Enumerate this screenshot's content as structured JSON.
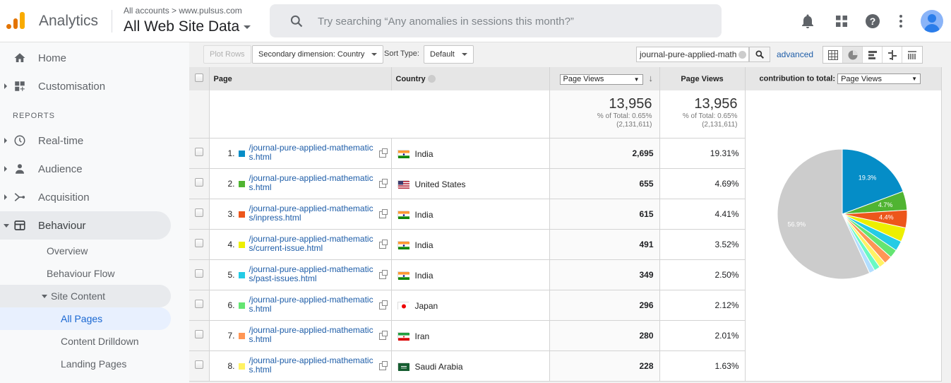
{
  "header": {
    "app_name": "Analytics",
    "breadcrumb": "All accounts > www.pulsus.com",
    "property": "All Web Site Data",
    "search_placeholder": "Try searching “Any anomalies in sessions this month?”",
    "icons": [
      "bell-icon",
      "apps-grid-icon",
      "help-icon",
      "more-vert-icon",
      "account-avatar-icon"
    ]
  },
  "sidebar": {
    "home": "Home",
    "customisation": "Customisation",
    "reports_label": "REPORTS",
    "realtime": "Real-time",
    "audience": "Audience",
    "acquisition": "Acquisition",
    "behaviour": "Behaviour",
    "behaviour_items": {
      "overview": "Overview",
      "flow": "Behaviour Flow",
      "site_content": "Site Content",
      "all_pages": "All Pages",
      "drilldown": "Content Drilldown",
      "landing": "Landing Pages"
    }
  },
  "toolbar": {
    "plot_rows": "Plot Rows",
    "secondary_dimension": "Secondary dimension: Country",
    "sort_type_label": "Sort Type:",
    "sort_type_value": "Default",
    "filter_value": "journal-pure-applied-math",
    "advanced": "advanced"
  },
  "table": {
    "headers": {
      "page": "Page",
      "country": "Country",
      "metric_select": "Page Views",
      "metric": "Page Views",
      "contribution_label": "contribution to total:",
      "contribution_select": "Page Views"
    },
    "totals": {
      "value": "13,956",
      "pct_of_total": "% of Total: 0.65%",
      "grand_total": "(2,131,611)"
    },
    "rows": [
      {
        "rank": "1.",
        "color": "#058dc7",
        "page": "/journal-pure-applied-mathematics.html",
        "country": "India",
        "flag": "in",
        "views": "2,695",
        "pct": "19.31%"
      },
      {
        "rank": "2.",
        "color": "#50b432",
        "page": "/journal-pure-applied-mathematics.html",
        "country": "United States",
        "flag": "us",
        "views": "655",
        "pct": "4.69%"
      },
      {
        "rank": "3.",
        "color": "#ed561b",
        "page": "/journal-pure-applied-mathematics/inpress.html",
        "country": "India",
        "flag": "in",
        "views": "615",
        "pct": "4.41%"
      },
      {
        "rank": "4.",
        "color": "#edef00",
        "page": "/journal-pure-applied-mathematics/current-issue.html",
        "country": "India",
        "flag": "in",
        "views": "491",
        "pct": "3.52%"
      },
      {
        "rank": "5.",
        "color": "#24cbe5",
        "page": "/journal-pure-applied-mathematics/past-issues.html",
        "country": "India",
        "flag": "in",
        "views": "349",
        "pct": "2.50%"
      },
      {
        "rank": "6.",
        "color": "#64e572",
        "page": "/journal-pure-applied-mathematics.html",
        "country": "Japan",
        "flag": "jp",
        "views": "296",
        "pct": "2.12%"
      },
      {
        "rank": "7.",
        "color": "#ff9655",
        "page": "/journal-pure-applied-mathematics.html",
        "country": "Iran",
        "flag": "ir",
        "views": "280",
        "pct": "2.01%"
      },
      {
        "rank": "8.",
        "color": "#fff263",
        "page": "/journal-pure-applied-mathematics.html",
        "country": "Saudi Arabia",
        "flag": "sa",
        "views": "228",
        "pct": "1.63%"
      }
    ]
  },
  "chart_data": {
    "type": "pie",
    "title": "contribution to total: Page Views",
    "slices": [
      {
        "label": "1",
        "value": 19.31,
        "color": "#058dc7",
        "data_label": "19.3%"
      },
      {
        "label": "2",
        "value": 4.69,
        "color": "#50b432",
        "data_label": "4.7%"
      },
      {
        "label": "3",
        "value": 4.41,
        "color": "#ed561b",
        "data_label": "4.4%"
      },
      {
        "label": "4",
        "value": 3.52,
        "color": "#edef00",
        "data_label": ""
      },
      {
        "label": "5",
        "value": 2.5,
        "color": "#24cbe5",
        "data_label": ""
      },
      {
        "label": "6",
        "value": 2.12,
        "color": "#64e572",
        "data_label": ""
      },
      {
        "label": "7",
        "value": 2.01,
        "color": "#ff9655",
        "data_label": ""
      },
      {
        "label": "8",
        "value": 1.63,
        "color": "#fff263",
        "data_label": ""
      },
      {
        "label": "9",
        "value": 1.5,
        "color": "#6af9c4",
        "data_label": ""
      },
      {
        "label": "10",
        "value": 1.4,
        "color": "#b2deff",
        "data_label": ""
      },
      {
        "label": "Other",
        "value": 56.9,
        "color": "#cccccc",
        "data_label": "56.9%"
      }
    ]
  }
}
